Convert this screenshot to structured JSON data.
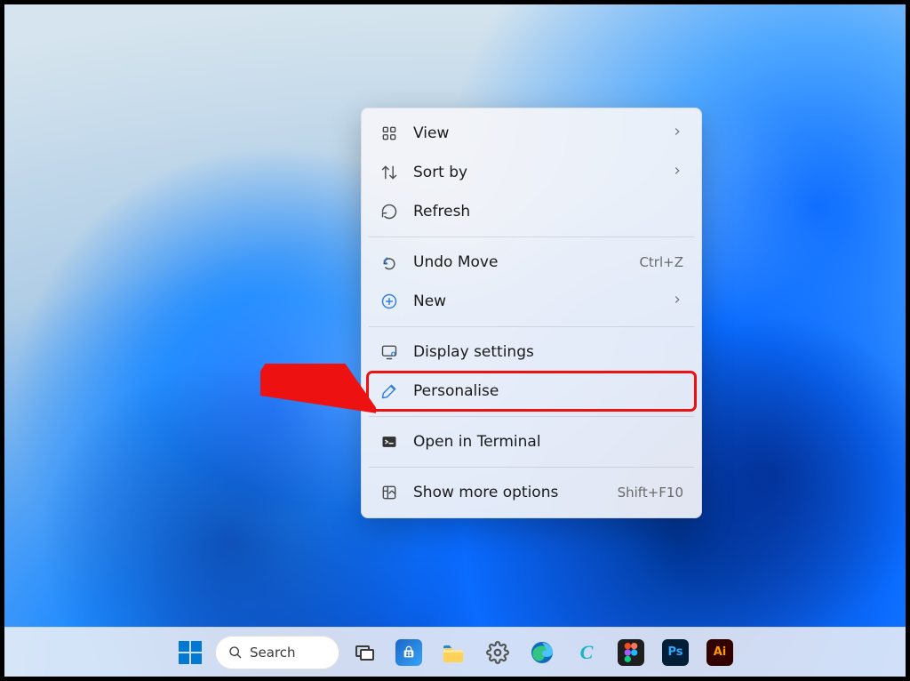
{
  "context_menu": {
    "sections": [
      [
        {
          "id": "view",
          "label": "View",
          "icon": "grid-icon",
          "submenu": true
        },
        {
          "id": "sort-by",
          "label": "Sort by",
          "icon": "sort-icon",
          "submenu": true
        },
        {
          "id": "refresh",
          "label": "Refresh",
          "icon": "refresh-icon"
        }
      ],
      [
        {
          "id": "undo-move",
          "label": "Undo Move",
          "icon": "undo-icon",
          "shortcut": "Ctrl+Z"
        },
        {
          "id": "new",
          "label": "New",
          "icon": "plus-icon",
          "submenu": true
        }
      ],
      [
        {
          "id": "display-settings",
          "label": "Display settings",
          "icon": "display-icon"
        },
        {
          "id": "personalise",
          "label": "Personalise",
          "icon": "brush-icon",
          "highlight": true
        }
      ],
      [
        {
          "id": "open-in-terminal",
          "label": "Open in Terminal",
          "icon": "terminal-icon"
        }
      ],
      [
        {
          "id": "show-more-options",
          "label": "Show more options",
          "icon": "more-icon",
          "shortcut": "Shift+F10"
        }
      ]
    ]
  },
  "taskbar": {
    "search_label": "Search",
    "items": [
      {
        "id": "start",
        "name": "start-button"
      },
      {
        "id": "search",
        "name": "search-pill"
      },
      {
        "id": "taskview",
        "name": "task-view-button"
      },
      {
        "id": "store",
        "name": "microsoft-store-button"
      },
      {
        "id": "explorer",
        "name": "file-explorer-button"
      },
      {
        "id": "settings",
        "name": "settings-button"
      },
      {
        "id": "edge",
        "name": "edge-button"
      },
      {
        "id": "copilot",
        "name": "copilot-button"
      },
      {
        "id": "figma",
        "name": "figma-button"
      },
      {
        "id": "photoshop",
        "name": "photoshop-button",
        "badge": "Ps"
      },
      {
        "id": "illustrator",
        "name": "illustrator-button",
        "badge": "Ai"
      }
    ]
  }
}
